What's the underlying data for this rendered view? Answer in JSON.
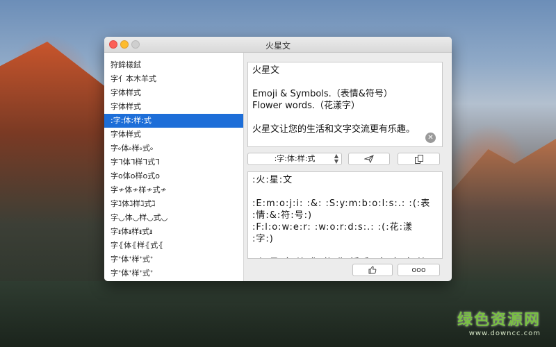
{
  "window": {
    "title": "火星文"
  },
  "sidebar": {
    "items": [
      "狩鉾樣鉽",
      "字亻本木羊式",
      "字体样式",
      "字体样式",
      ":字:体:样:式",
      "字体样式",
      "字৹体৹样৹式৹",
      "字ᒣ体ᒣ样ᒣ式ᒣ",
      "字o体o样o式o",
      "字≁体≁样≁式≁",
      "字ℷ体ℷ样ℷ式ℷ",
      "字◡体◡样◡式◡",
      "字ᵻ体ᵻ样ᵻ式ᵻ",
      "字⦃体⦃样⦃式⦃",
      "字ᐩ体ᐩ样ᐩ式ᐩ",
      "字ᐩ体ᐩ样ᐩ式ᐩ"
    ],
    "selected_index": 4
  },
  "input": {
    "lines": [
      "火星文",
      "",
      "Emoji & Symbols.（表情&符号）",
      "Flower words.（花漾字）",
      "",
      "火星文让您的生活和文字交流更有乐趣。"
    ],
    "clear_icon": "clear-icon"
  },
  "controls": {
    "style_select_value": ":字:体:样:式",
    "send_icon": "paper-plane-icon",
    "copy_icon": "copy-icon"
  },
  "output": {
    "lines": [
      ":火:星:文",
      "",
      ":E:m:o:j:i: :&: :S:y:m:b:o:l:s:.: :(:表",
      ":情:&:符:号:)",
      ":F:l:o:w:e:r: :w:o:r:d:s:.: :(:花:漾",
      ":字:)",
      "",
      ":火:星:文:让:您:的:生:活:和:文:字:交:流"
    ]
  },
  "bottom": {
    "like_icon": "thumbs-up-icon",
    "more_label": "ooo"
  },
  "watermark": {
    "title": "绿色资源网",
    "url": "www.downcc.com"
  },
  "colors": {
    "selection": "#1d6ed8",
    "close": "#fc5f57",
    "minimize": "#fdbc2e",
    "watermark": "#79c142"
  }
}
